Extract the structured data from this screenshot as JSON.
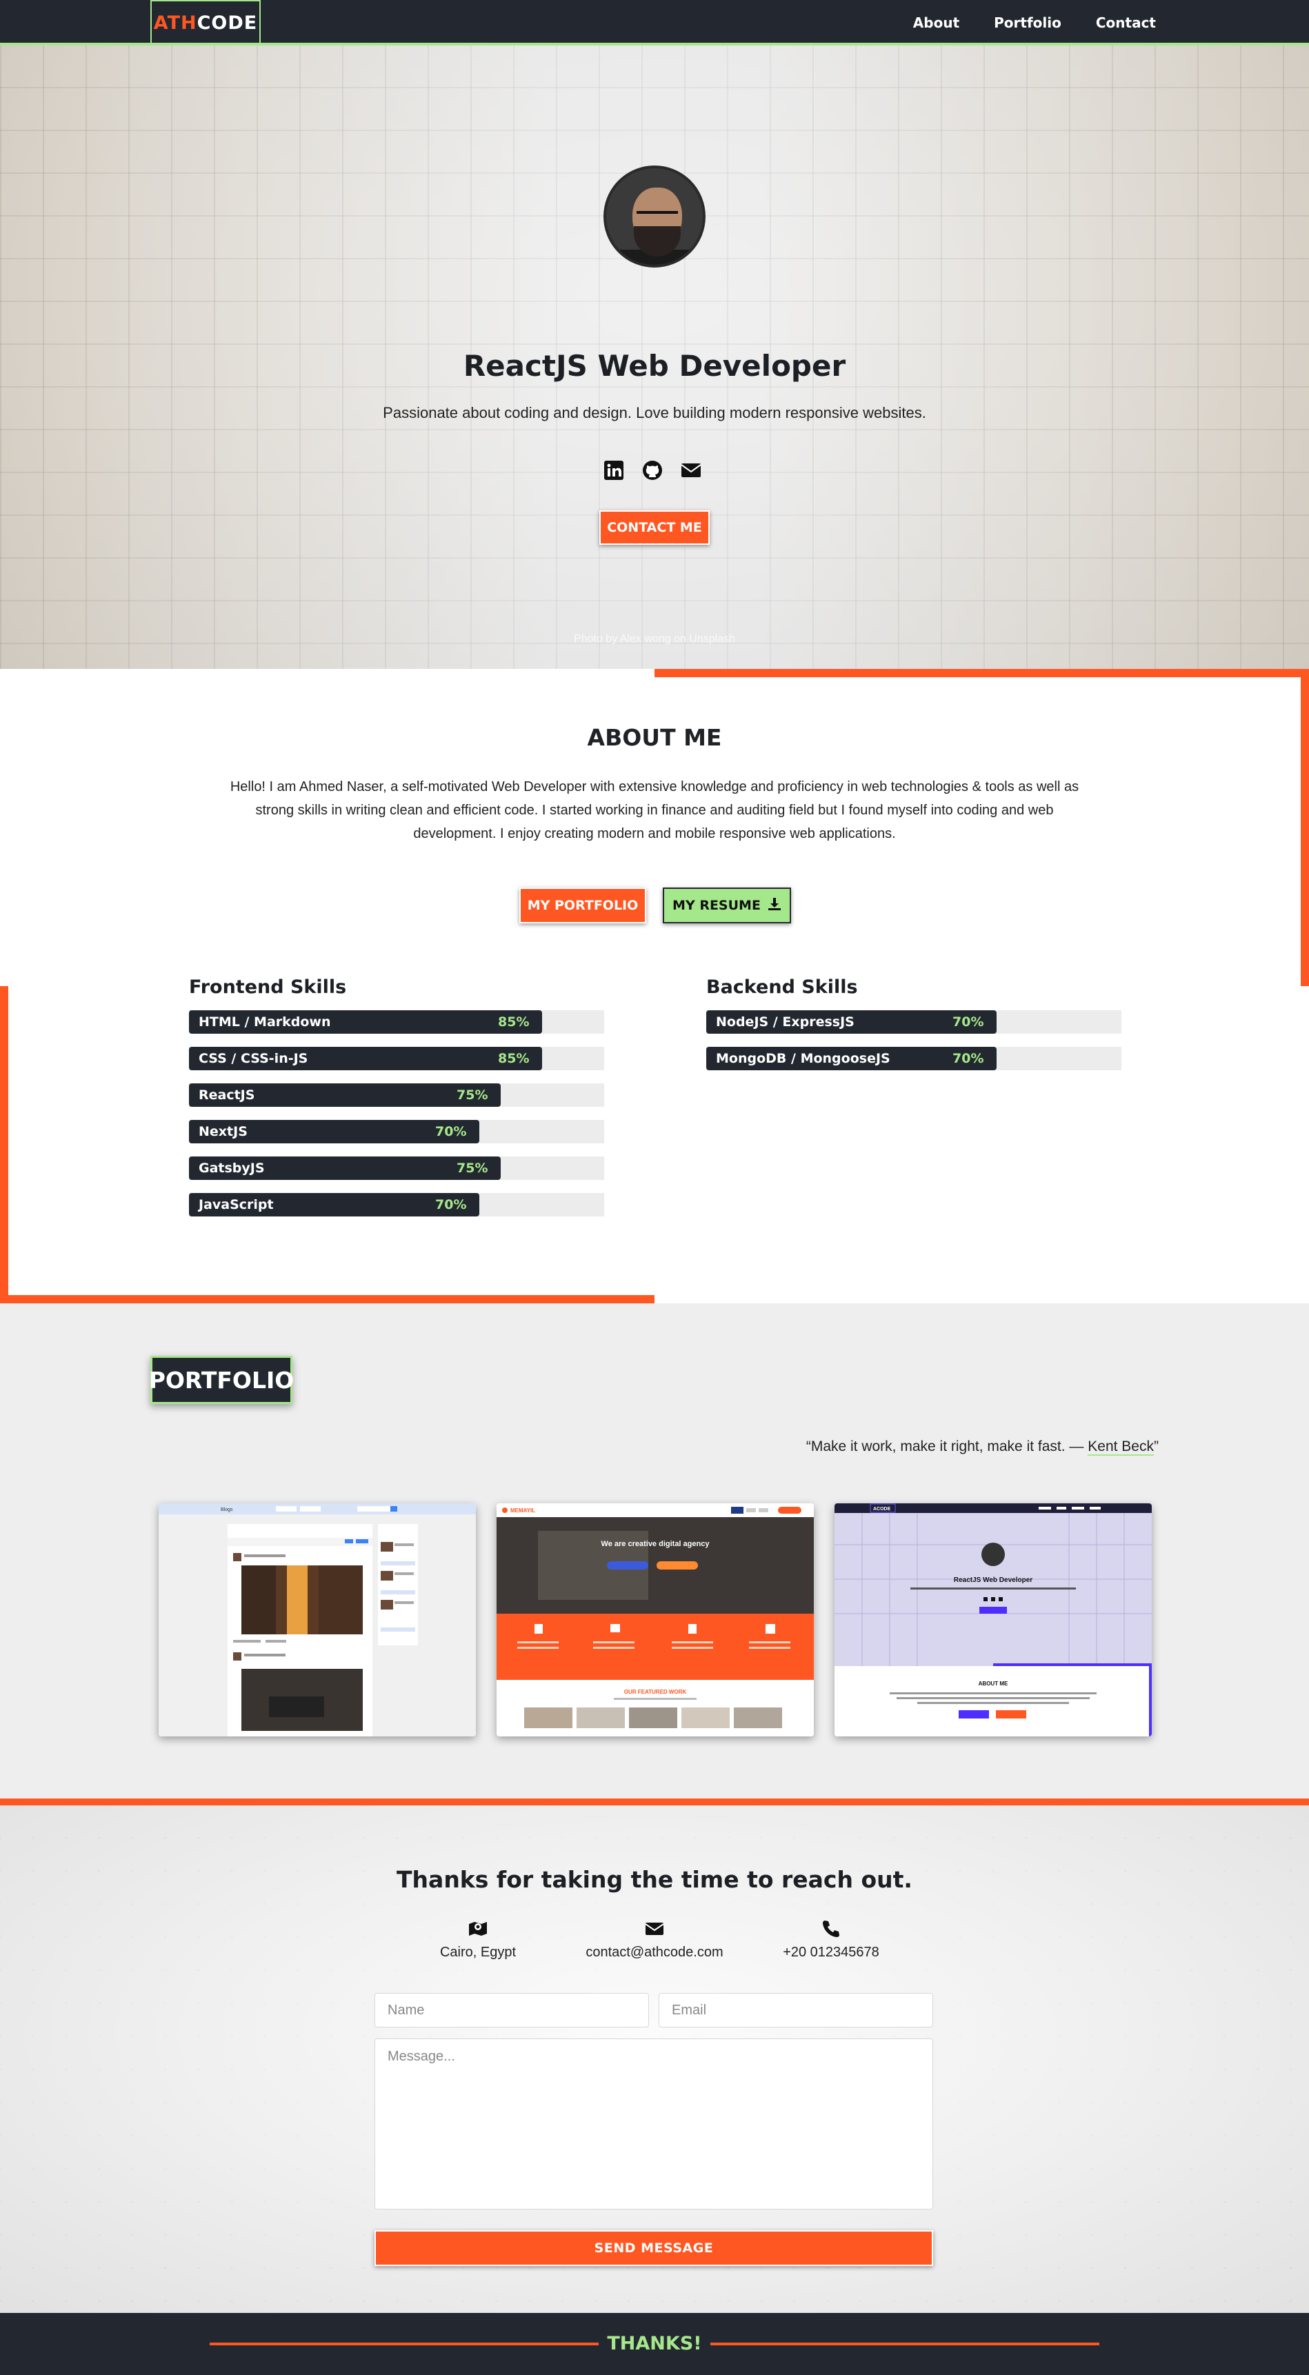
{
  "nav": {
    "logo_accent": "ATH",
    "logo_main": "CODE",
    "links": [
      "About",
      "Portfolio",
      "Contact"
    ]
  },
  "hero": {
    "title": "ReactJS Web Developer",
    "subtitle": "Passionate about coding and design. Love building modern responsive websites.",
    "social_icons": [
      "linkedin-icon",
      "github-icon",
      "envelope-icon"
    ],
    "cta_label": "CONTACT ME",
    "photo_credit": "Photo by Alex wong on Unsplash"
  },
  "about": {
    "title": "ABOUT ME",
    "text": "Hello! I am Ahmed Naser, a self-motivated Web Developer with extensive knowledge and proficiency in web technologies & tools as well as strong skills in writing clean and efficient code. I started working in finance and auditing field but I found myself into coding and web development. I enjoy creating modern and mobile responsive web applications.",
    "portfolio_button": "MY PORTFOLIO",
    "resume_button": "MY RESUME",
    "frontend": {
      "title": "Frontend Skills",
      "skills": [
        {
          "name": "HTML / Markdown",
          "pct": "85%",
          "level": 85
        },
        {
          "name": "CSS / CSS-in-JS",
          "pct": "85%",
          "level": 85
        },
        {
          "name": "ReactJS",
          "pct": "75%",
          "level": 75
        },
        {
          "name": "NextJS",
          "pct": "70%",
          "level": 70
        },
        {
          "name": "GatsbyJS",
          "pct": "75%",
          "level": 75
        },
        {
          "name": "JavaScript",
          "pct": "70%",
          "level": 70
        }
      ]
    },
    "backend": {
      "title": "Backend Skills",
      "skills": [
        {
          "name": "NodeJS / ExpressJS",
          "pct": "70%",
          "level": 70
        },
        {
          "name": "MongoDB / MongooseJS",
          "pct": "70%",
          "level": 70
        }
      ]
    }
  },
  "portfolio": {
    "title": "PORTFOLIO",
    "quote_text": "“Make it work, make it right, make it fast. — ",
    "quote_author": "Kent Beck",
    "quote_end": "”",
    "projects": [
      {
        "mini_title": "Blogs"
      },
      {
        "mini_brand": "MEMAYIL",
        "mini_headline": "We are creative digital agency",
        "mini_section": "OUR FEATURED WORK"
      },
      {
        "mini_brand": "ACODE",
        "mini_headline": "ReactJS Web Developer",
        "mini_section": "ABOUT ME"
      }
    ]
  },
  "contact": {
    "title": "Thanks for taking the time to reach out.",
    "location": "Cairo, Egypt",
    "email": "contact@athcode.com",
    "phone": "+20 012345678",
    "name_placeholder": "Name",
    "email_placeholder": "Email",
    "message_placeholder": "Message...",
    "send_label": "SEND MESSAGE"
  },
  "footer": {
    "text": "THANKS!"
  },
  "colors": {
    "accent": "#ff5722",
    "green": "#a5e88b",
    "dark": "#232830"
  }
}
